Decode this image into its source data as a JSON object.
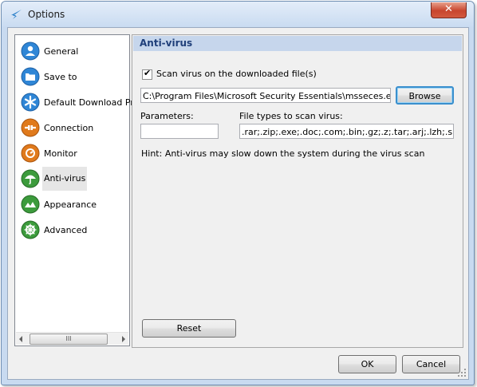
{
  "window": {
    "title": "Options",
    "close_label": "✕"
  },
  "sidebar": {
    "items": [
      {
        "label": "General",
        "icon": "general-icon",
        "color": "#2f86d6"
      },
      {
        "label": "Save to",
        "icon": "folder-icon",
        "color": "#2f86d6"
      },
      {
        "label": "Default Download Pr",
        "icon": "asterisk-icon",
        "color": "#2f86d6"
      },
      {
        "label": "Connection",
        "icon": "connection-icon",
        "color": "#e07a1c"
      },
      {
        "label": "Monitor",
        "icon": "monitor-icon",
        "color": "#e07a1c"
      },
      {
        "label": "Anti-virus",
        "icon": "umbrella-icon",
        "color": "#3c9b3c",
        "selected": true
      },
      {
        "label": "Appearance",
        "icon": "appearance-icon",
        "color": "#3c9b3c"
      },
      {
        "label": "Advanced",
        "icon": "advanced-icon",
        "color": "#3c9b3c"
      }
    ],
    "scroll_thumb": "III"
  },
  "antivirus": {
    "header": "Anti-virus",
    "scan_checkbox_label": "Scan virus on the downloaded file(s)",
    "scan_checked": true,
    "program_path": "C:\\Program Files\\Microsoft Security Essentials\\msseces.exe",
    "browse_label": "Browse",
    "parameters_label": "Parameters:",
    "parameters_value": "",
    "file_types_label": "File types to scan virus:",
    "file_types_value": ".rar;.zip;.exe;.doc;.com;.bin;.gz;.z;.tar;.arj;.lzh;.sit;.l",
    "hint": "Hint: Anti-virus may slow down the system during the virus scan",
    "reset_label": "Reset"
  },
  "footer": {
    "ok_label": "OK",
    "cancel_label": "Cancel"
  }
}
